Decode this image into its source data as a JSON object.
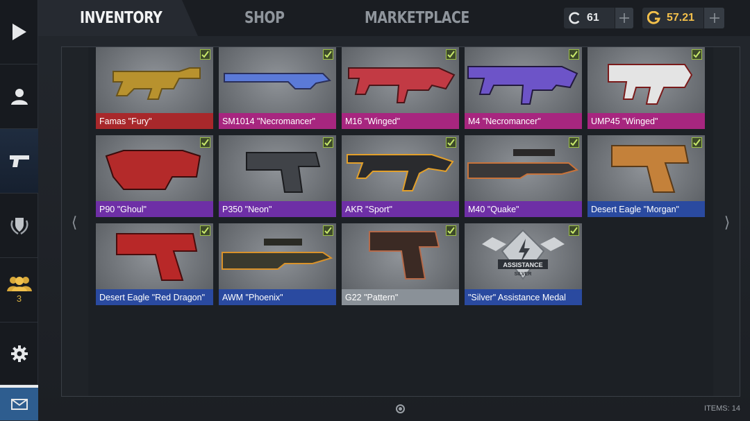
{
  "tabs": {
    "inventory": "INVENTORY",
    "shop": "SHOP",
    "marketplace": "MARKETPLACE"
  },
  "currency": {
    "coins": "61",
    "gold": "57.21"
  },
  "sidebar": {
    "clan_count": "3"
  },
  "items": [
    {
      "name": "Famas \"Fury\"",
      "rarity": "red"
    },
    {
      "name": "SM1014 \"Necromancer\"",
      "rarity": "pink"
    },
    {
      "name": "M16 \"Winged\"",
      "rarity": "pink"
    },
    {
      "name": "M4 \"Necromancer\"",
      "rarity": "pink"
    },
    {
      "name": "UMP45 \"Winged\"",
      "rarity": "pink"
    },
    {
      "name": "P90 \"Ghoul\"",
      "rarity": "purple"
    },
    {
      "name": "P350 \"Neon\"",
      "rarity": "purple"
    },
    {
      "name": "AKR \"Sport\"",
      "rarity": "purple"
    },
    {
      "name": "M40 \"Quake\"",
      "rarity": "purple"
    },
    {
      "name": "Desert Eagle \"Morgan\"",
      "rarity": "blue"
    },
    {
      "name": "Desert Eagle \"Red Dragon\"",
      "rarity": "blue"
    },
    {
      "name": "AWM \"Phoenix\"",
      "rarity": "blue"
    },
    {
      "name": "G22 \"Pattern\"",
      "rarity": "grey"
    },
    {
      "name": "\"Silver\" Assistance Medal",
      "rarity": "blue"
    }
  ],
  "medal": {
    "line1": "ASSISTANCE",
    "line2": "SILVER"
  },
  "footer": {
    "items_count": "ITEMS: 14"
  },
  "colors": {
    "red": "#a8282b",
    "pink": "#a7267f",
    "purple": "#6e2fa6",
    "blue": "#2a4aa0",
    "grey": "#8a9198",
    "gold": "#f3c04b"
  }
}
